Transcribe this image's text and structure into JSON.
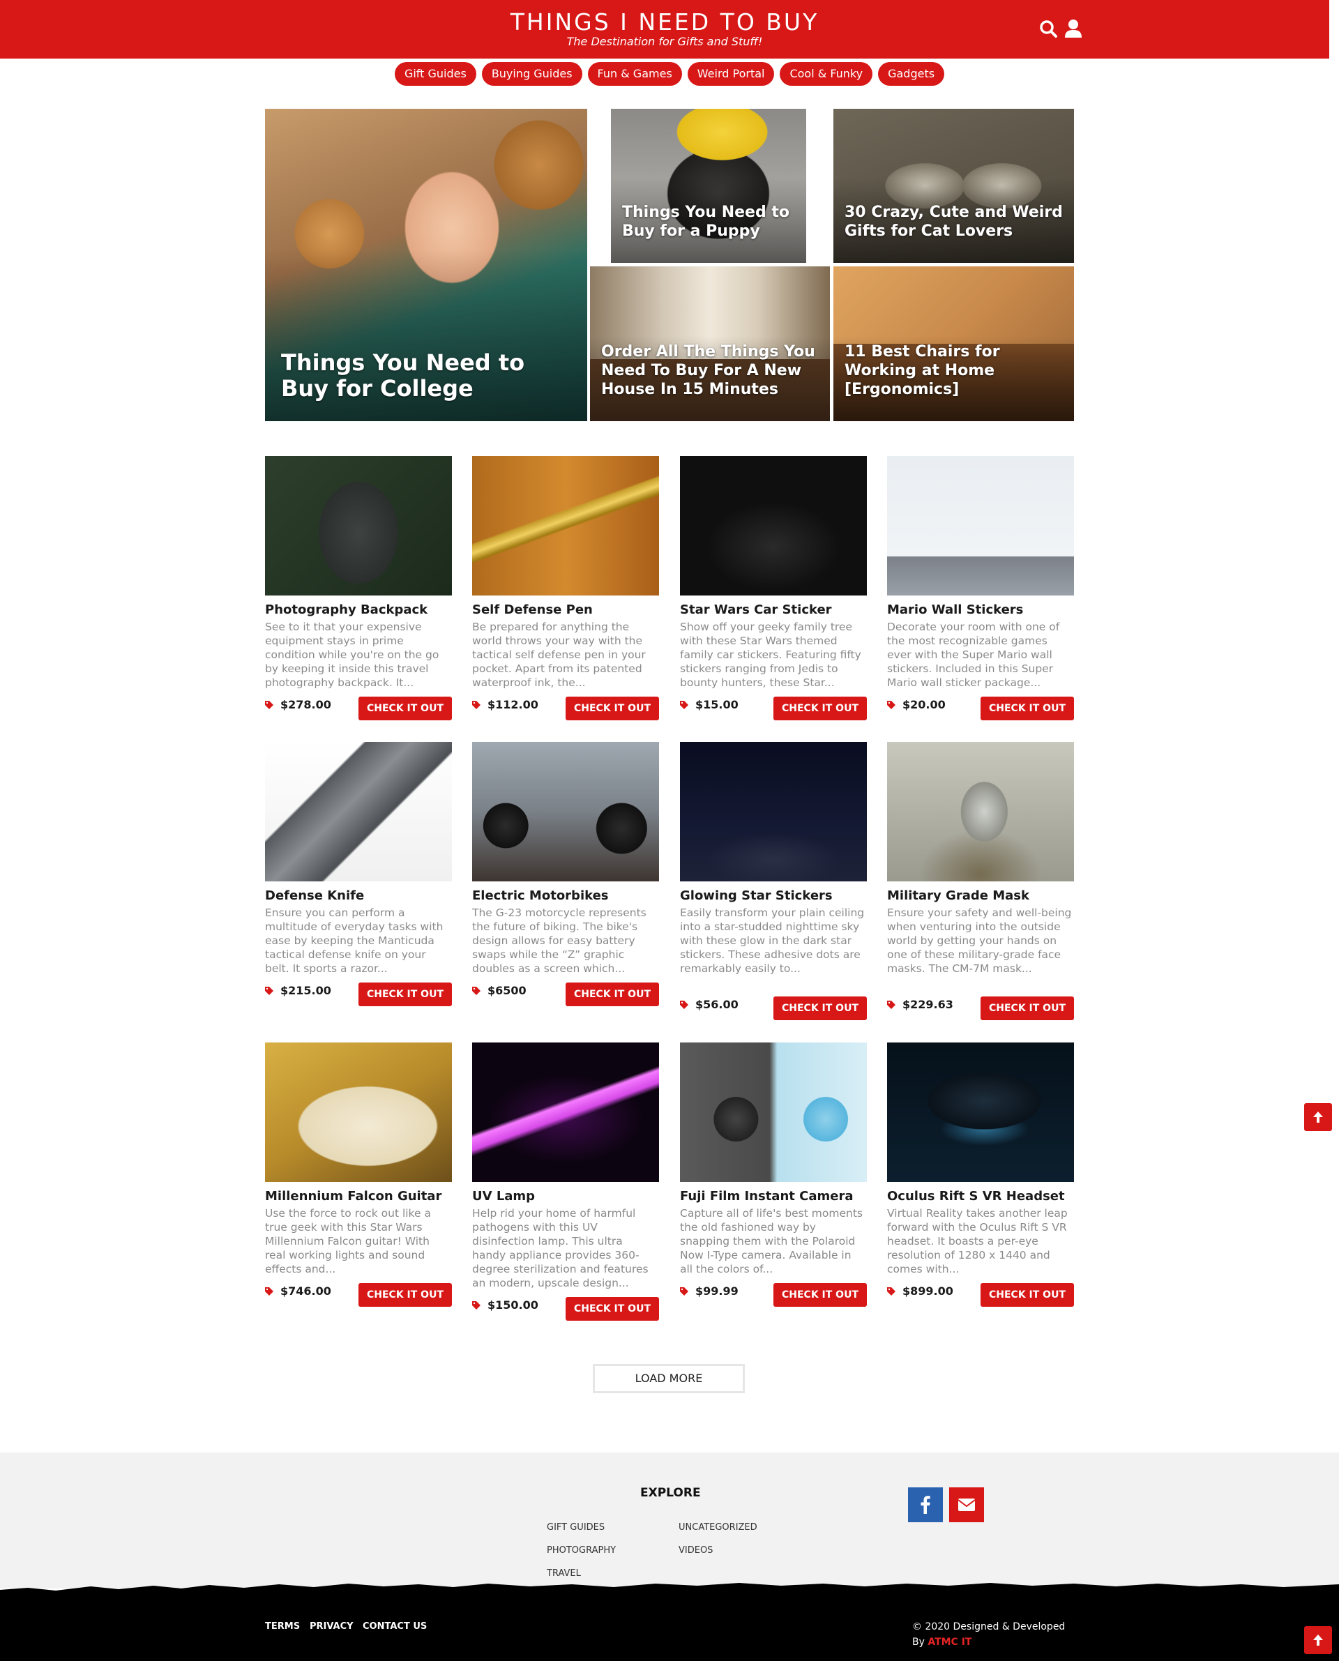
{
  "header": {
    "title": "THINGS I NEED TO BUY",
    "tagline": "The Destination for Gifts and Stuff!",
    "icons": [
      "search-icon",
      "user-icon"
    ]
  },
  "nav": [
    "Gift Guides",
    "Buying Guides",
    "Fun & Games",
    "Weird Portal",
    "Cool & Funky",
    "Gadgets"
  ],
  "featured": [
    "Things You Need to Buy for College",
    "Things You Need to Buy for a Puppy",
    "30 Crazy, Cute and Weird Gifts for Cat Lovers",
    "Order All The Things You Need To Buy For A New House In 15 Minutes",
    "11 Best Chairs for Working at Home [Ergonomics]"
  ],
  "cta_label": "CHECK IT OUT",
  "products": [
    {
      "name": "Photography Backpack",
      "desc": "See to it that your expensive equipment stays in prime condition while you're on the go by keeping it inside this travel photography backpack. It...",
      "price": "$278.00"
    },
    {
      "name": "Self Defense Pen",
      "desc": "Be prepared for anything the world throws your way with the tactical self defense pen in your pocket. Apart from its patented waterproof ink, the...",
      "price": "$112.00"
    },
    {
      "name": "Star Wars Car Sticker",
      "desc": "Show off your geeky family tree with these Star Wars themed family car stickers. Featuring fifty stickers ranging from Jedis to bounty hunters, these Star...",
      "price": "$15.00"
    },
    {
      "name": "Mario Wall Stickers",
      "desc": "Decorate your room with one of the most recognizable games ever with the Super Mario wall stickers. Included in this Super Mario wall sticker package...",
      "price": "$20.00"
    },
    {
      "name": "Defense Knife",
      "desc": "Ensure you can perform a multitude of everyday tasks with ease by keeping the Manticuda tactical defense knife on your belt. It sports a razor...",
      "price": "$215.00"
    },
    {
      "name": "Electric Motorbikes",
      "desc": "The G-23 motorcycle represents the future of biking. The bike's design allows for easy battery swaps while the “Z” graphic doubles as a screen which...",
      "price": "$6500"
    },
    {
      "name": "Glowing Star Stickers",
      "desc": "Easily transform your plain ceiling into a star-studded nighttime sky with these glow in the dark star stickers. These adhesive dots are remarkably easily to...",
      "price": "$56.00"
    },
    {
      "name": "Military Grade Mask",
      "desc": "Ensure your safety and well-being when venturing into the outside world by getting your hands on one of these military-grade face masks. The CM-7M mask...",
      "price": "$229.63"
    },
    {
      "name": "Millennium Falcon Guitar",
      "desc": "Use the force to rock out like a true geek with this Star Wars Millennium Falcon guitar! With real working lights and sound effects and...",
      "price": "$746.00"
    },
    {
      "name": "UV Lamp",
      "desc": "Help rid your home of harmful pathogens with this UV disinfection lamp. This ultra handy appliance provides 360-degree sterilization and features an modern, upscale design...",
      "price": "$150.00"
    },
    {
      "name": "Fuji Film Instant Camera",
      "desc": "Capture all of life's best moments the old fashioned way by snapping them with the Polaroid Now I-Type camera. Available in all the colors of...",
      "price": "$99.99"
    },
    {
      "name": "Oculus Rift S VR Headset",
      "desc": "Virtual Reality takes another leap forward with the Oculus Rift S VR headset. It boasts a per-eye resolution of 1280 x 1440 and comes with...",
      "price": "$899.00"
    }
  ],
  "load_more": "LOAD MORE",
  "footer": {
    "explore_title": "EXPLORE",
    "links_col1": [
      "GIFT GUIDES",
      "PHOTOGRAPHY",
      "TRAVEL"
    ],
    "links_col2": [
      "UNCATEGORIZED",
      "VIDEOS"
    ],
    "social": [
      "facebook-icon",
      "email-icon"
    ],
    "bottom_links": [
      "TERMS",
      "PRIVACY",
      "CONTACT US"
    ],
    "copyright": "© 2020 Designed & Developed",
    "by_label": "By",
    "brand": "ATMC IT"
  },
  "colors": {
    "accent": "#d81717",
    "facebook": "#2a62b0",
    "footer_bg": "#f2f2f2"
  }
}
